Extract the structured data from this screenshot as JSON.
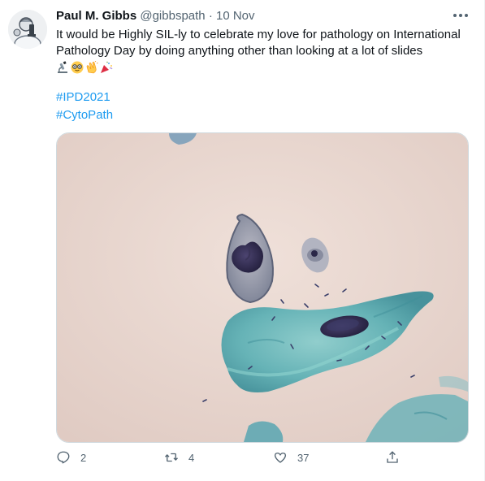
{
  "tweet": {
    "display_name": "Paul M. Gibbs",
    "handle": "@gibbspath",
    "separator": "·",
    "date": "10 Nov",
    "text": "It would be Highly SIL-ly to celebrate my love for pathology on International Pathology Day by doing anything other than looking at a lot of slides",
    "emojis": [
      "microscope-icon",
      "nerd-face-icon",
      "clapping-hands-icon",
      "party-popper-icon"
    ],
    "hashtags": [
      "#IPD2021",
      "#CytoPath"
    ],
    "media": {
      "type": "photo",
      "subject": "cytology slide with squamous cells",
      "palette": {
        "background": "#e8d6cf",
        "cell_teal": "#5fb1b5",
        "nucleus": "#2e2950"
      }
    }
  },
  "actions": {
    "reply_count": "2",
    "retweet_count": "4",
    "like_count": "37"
  },
  "colors": {
    "text": "#0f1419",
    "secondary": "#536471",
    "link": "#1d9bf0"
  }
}
